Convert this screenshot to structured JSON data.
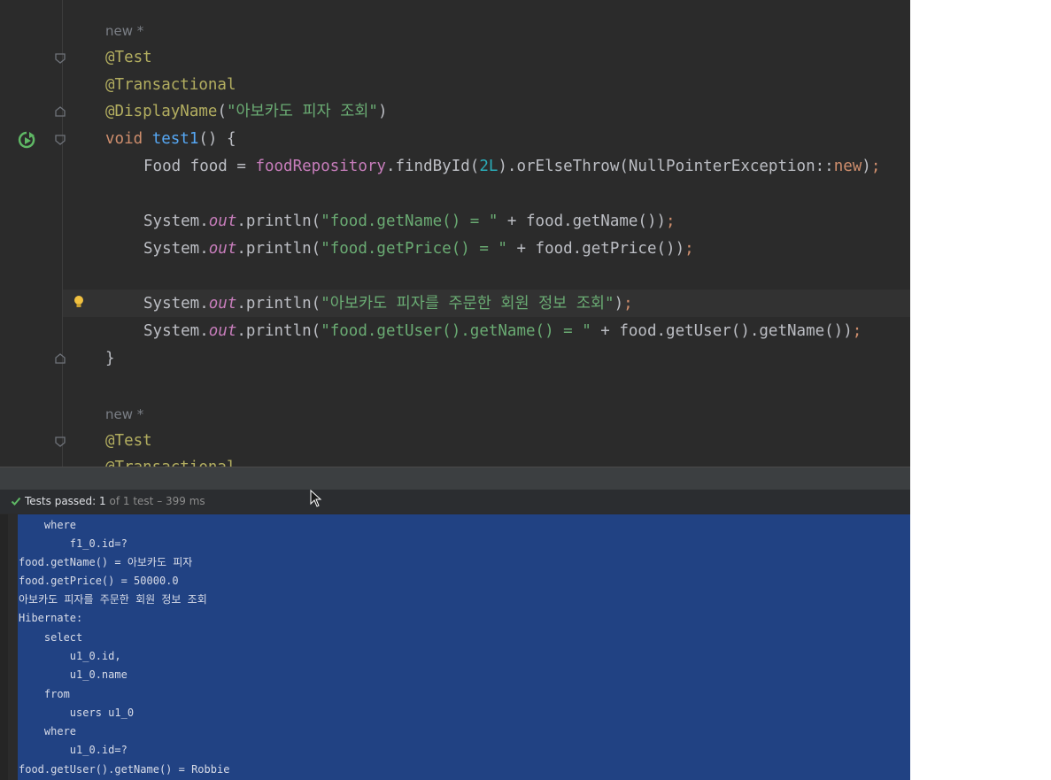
{
  "editor": {
    "hint1": "new *",
    "hint2": "new *",
    "l_test1": "@Test",
    "l_tx1": "@Transactional",
    "l_dn_ann": "@DisplayName",
    "l_dn_str": "\"아보카도 피자 조회\"",
    "l_void": "void",
    "l_method": "test1",
    "l_food_type": "Food food = ",
    "l_repo": "foodRepository",
    "l_find": ".findById(",
    "l_2L": "2L",
    "l_orElse": ").orElseThrow(NullPointerException::",
    "l_new": "new",
    "l_sys": "System.",
    "l_out": "out",
    "l_println": ".println(",
    "l_str1": "\"food.getName() = \"",
    "l_expr1": " + food.getName())",
    "l_str2": "\"food.getPrice() = \"",
    "l_expr2": " + food.getPrice())",
    "l_str3": "\"아보카도 피자를 주문한 회원 정보 조회\"",
    "l_str4": "\"food.getUser().getName() = \"",
    "l_expr4": " + food.getUser().getName())",
    "l_close": "}",
    "l_test2": "@Test",
    "l_tx2": "@Transactional"
  },
  "status": {
    "label": "Tests passed:",
    "count": "1",
    "detail": "of 1 test – 399 ms"
  },
  "console": [
    "    where",
    "        f1_0.id=?",
    "food.getName() = 아보카도 피자",
    "food.getPrice() = 50000.0",
    "아보카도 피자를 주문한 회원 정보 조회",
    "Hibernate: ",
    "    select",
    "        u1_0.id,",
    "        u1_0.name",
    "    from",
    "        users u1_0",
    "    where",
    "        u1_0.id=?",
    "food.getUser().getName() = Robbie"
  ],
  "colors": {
    "selection": "#214283",
    "pass": "#5fb865",
    "editor_bg": "#2b2b2b"
  },
  "icons": [
    "run-test-icon",
    "fold-icon",
    "bulb-icon",
    "check-icon",
    "cursor-icon"
  ]
}
